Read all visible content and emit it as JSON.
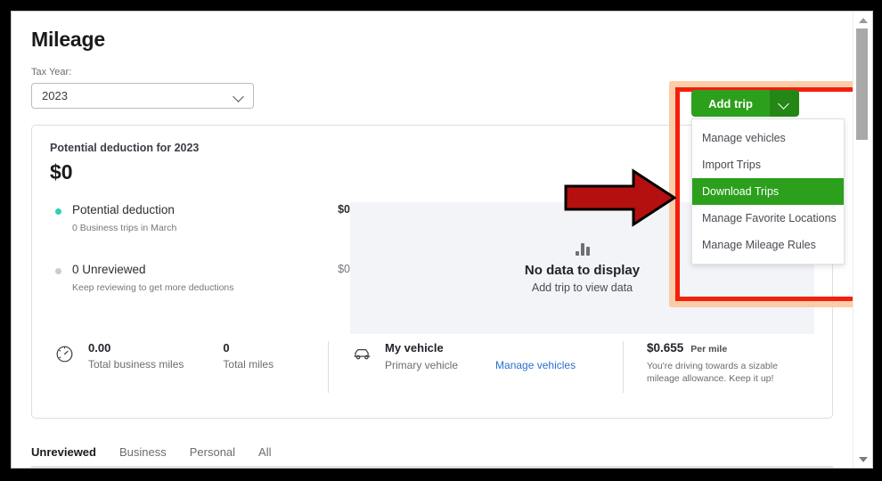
{
  "page": {
    "title": "Mileage",
    "tax_year_label": "Tax Year:",
    "tax_year_value": "2023"
  },
  "card": {
    "heading": "Potential deduction for 2023",
    "amount": "$0",
    "legend": [
      {
        "title": "Potential deduction",
        "subtitle": "0 Business trips in March",
        "value": "$0",
        "dot_color": "#2fd0b4"
      },
      {
        "title": "0 Unreviewed",
        "subtitle": "Keep reviewing to get more deductions",
        "value": "$0",
        "dot_color": "#c9cbd1"
      }
    ],
    "empty_state": {
      "icon": "bar-chart-icon",
      "title": "No data to display",
      "subtitle": "Add trip to view data"
    }
  },
  "stats": {
    "mileage": {
      "icon": "speedometer-icon",
      "business_miles_value": "0.00",
      "business_miles_label": "Total business miles",
      "total_miles_value": "0",
      "total_miles_label": "Total miles"
    },
    "vehicle": {
      "icon": "car-icon",
      "name": "My vehicle",
      "subtitle": "Primary vehicle",
      "link": "Manage vehicles"
    },
    "rate": {
      "amount": "$0.655",
      "unit": "Per mile",
      "note": "You're driving towards a sizable mileage allowance. Keep it up!"
    }
  },
  "tabs": [
    {
      "label": "Unreviewed",
      "active": true
    },
    {
      "label": "Business",
      "active": false
    },
    {
      "label": "Personal",
      "active": false
    },
    {
      "label": "All",
      "active": false
    }
  ],
  "add_trip": {
    "label": "Add trip",
    "caret_icon": "chevron-down-icon",
    "menu": [
      {
        "label": "Manage vehicles",
        "selected": false
      },
      {
        "label": "Import Trips",
        "selected": false
      },
      {
        "label": "Download Trips",
        "selected": true
      },
      {
        "label": "Manage Favorite Locations",
        "selected": false
      },
      {
        "label": "Manage Mileage Rules",
        "selected": false
      }
    ]
  },
  "annotations": {
    "highlight_color": "#f41f0c",
    "glow_color": "#fbc49a",
    "arrow_color": "#b51010",
    "arrow_points_to": "Download Trips"
  },
  "colors": {
    "brand_green": "#2ca01c",
    "link_blue": "#2c6fd1",
    "panel_bg": "#f2f4f8"
  }
}
